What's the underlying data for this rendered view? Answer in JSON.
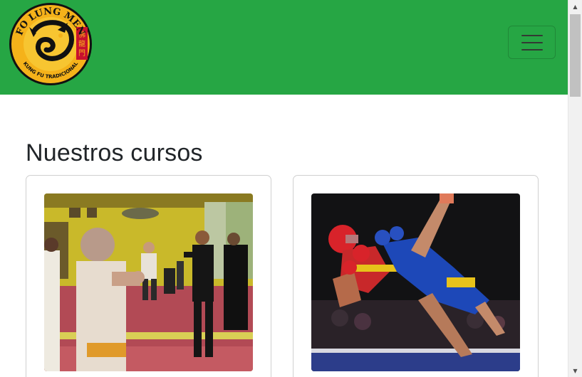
{
  "navbar": {
    "brand_logo": {
      "top_text": "FO LUNG MEN",
      "bottom_text": "KUNG FU TRADICIONAL",
      "chinese_text": "佛龍門",
      "icon": "dragon-logo"
    },
    "toggler_icon": "hamburger-menu-icon"
  },
  "main": {
    "title": "Nuestros cursos",
    "courses": [
      {
        "image_desc_icon": "kung-fu-class-photo"
      },
      {
        "image_desc_icon": "sanda-kick-photo"
      }
    ]
  },
  "colors": {
    "navbar_bg": "#26a644",
    "logo_gold": "#f5b21a",
    "logo_red": "#c8102e"
  },
  "scrollbar": {
    "up_icon": "scroll-up-arrow-icon",
    "down_icon": "scroll-down-arrow-icon"
  }
}
